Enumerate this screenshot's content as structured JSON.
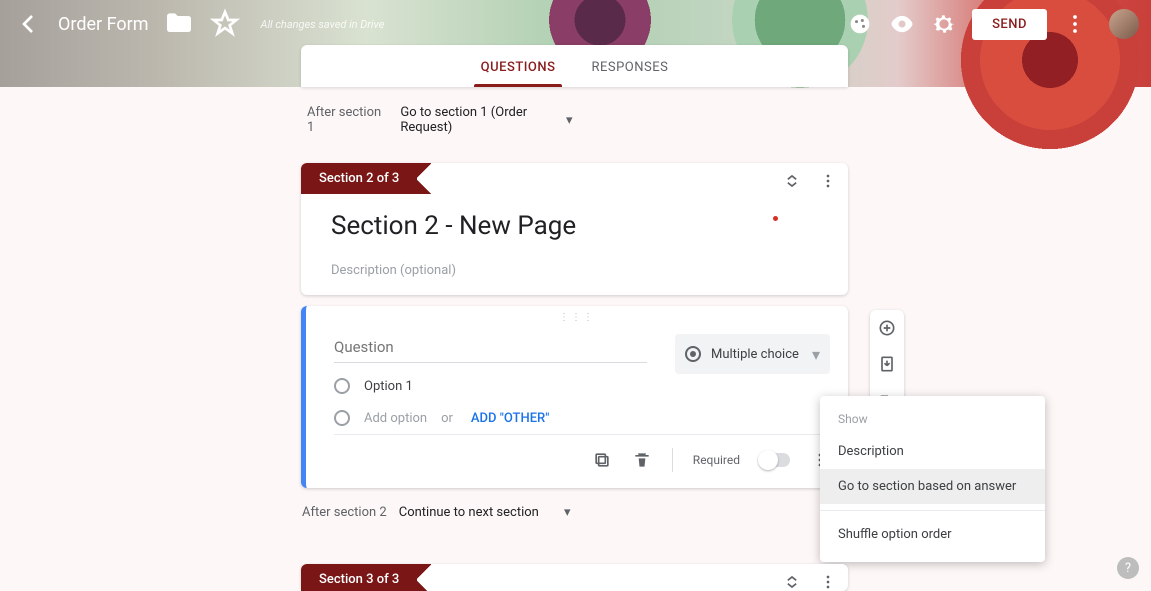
{
  "header": {
    "title": "Order Form",
    "saved": "All changes saved in Drive",
    "send": "SEND"
  },
  "tabs": {
    "questions": "QUESTIONS",
    "responses": "RESPONSES"
  },
  "afterSection1": {
    "label": "After section 1",
    "value": "Go to section 1 (Order Request)"
  },
  "section2": {
    "ribbon": "Section 2 of 3",
    "title": "Section 2 - New Page",
    "desc": "Description (optional)"
  },
  "question": {
    "placeholder": "Question",
    "type": "Multiple choice",
    "option1": "Option 1",
    "addOption": "Add option",
    "or": "or",
    "addOther": "ADD \"OTHER\"",
    "required": "Required"
  },
  "afterSection2": {
    "label": "After section 2",
    "value": "Continue to next section"
  },
  "section3": {
    "ribbon": "Section 3 of 3"
  },
  "menu": {
    "show": "Show",
    "desc": "Description",
    "goto": "Go to section based on answer",
    "shuffle": "Shuffle option order"
  }
}
